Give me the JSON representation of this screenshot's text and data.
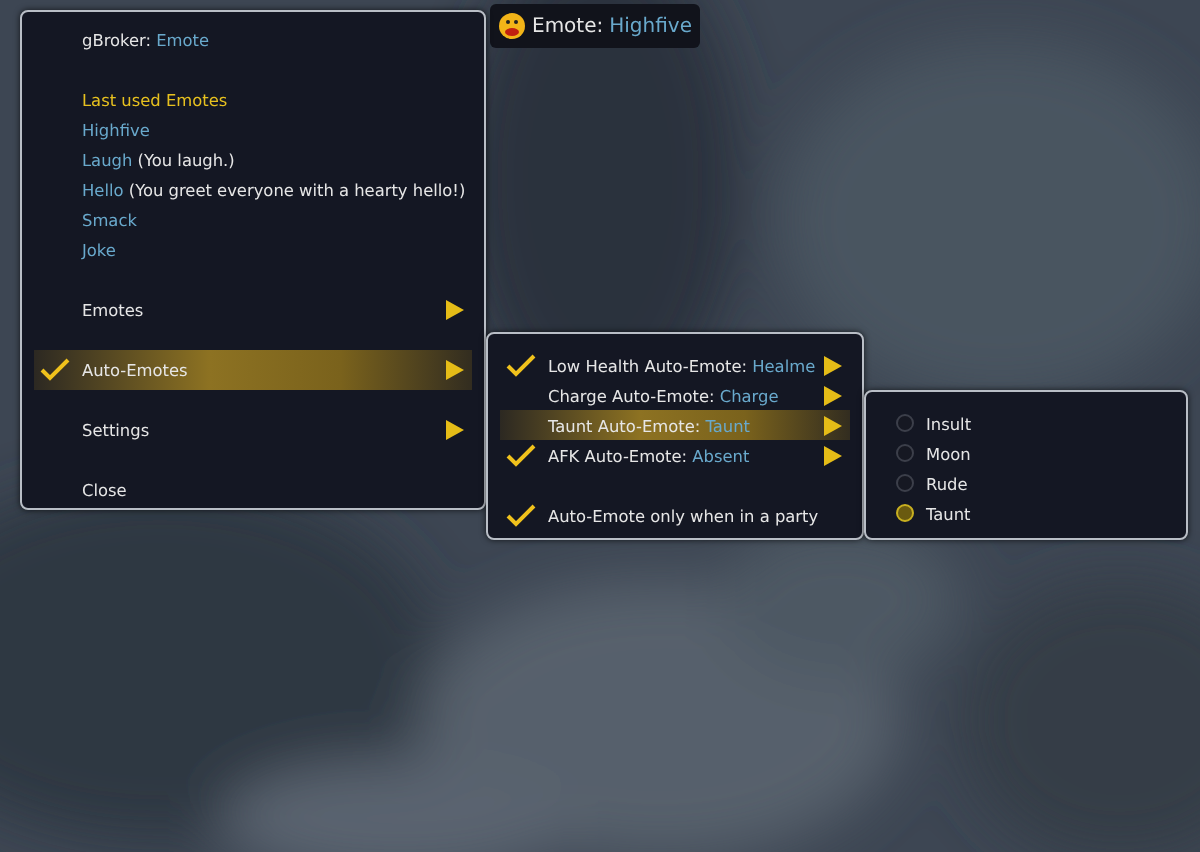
{
  "broker": {
    "label": "Emote:",
    "value": "Highfive"
  },
  "main_menu": {
    "title_label": "gBroker:",
    "title_value": "Emote",
    "section": "Last used Emotes",
    "recent": [
      {
        "name": "Highfive"
      },
      {
        "name": "Laugh",
        "description": "(You laugh.)"
      },
      {
        "name": "Hello",
        "description": "(You greet everyone with a hearty hello!)"
      },
      {
        "name": "Smack"
      },
      {
        "name": "Joke"
      }
    ],
    "items": [
      {
        "label": "Emotes",
        "checked": false,
        "highlighted": false,
        "has_submenu": true
      },
      {
        "label": "Auto-Emotes",
        "checked": true,
        "highlighted": true,
        "has_submenu": true
      },
      {
        "label": "Settings",
        "checked": false,
        "highlighted": false,
        "has_submenu": true
      },
      {
        "label": "Close",
        "checked": false,
        "highlighted": false,
        "has_submenu": false
      }
    ]
  },
  "auto_emotes_menu": {
    "items": [
      {
        "label": "Low Health Auto-Emote:",
        "value": "Healme",
        "checked": true,
        "highlighted": false,
        "has_submenu": true,
        "gap_before": false
      },
      {
        "label": "Charge Auto-Emote:",
        "value": "Charge",
        "checked": false,
        "highlighted": false,
        "has_submenu": true,
        "gap_before": false
      },
      {
        "label": "Taunt Auto-Emote:",
        "value": "Taunt",
        "checked": false,
        "highlighted": true,
        "has_submenu": true,
        "gap_before": false
      },
      {
        "label": "AFK Auto-Emote:",
        "value": "Absent",
        "checked": true,
        "highlighted": false,
        "has_submenu": true,
        "gap_before": false
      },
      {
        "label": "Auto-Emote only when in a party",
        "checked": true,
        "highlighted": false,
        "has_submenu": false,
        "gap_before": true
      }
    ]
  },
  "taunt_menu": {
    "options": [
      {
        "label": "Insult",
        "selected": false
      },
      {
        "label": "Moon",
        "selected": false
      },
      {
        "label": "Rude",
        "selected": false
      },
      {
        "label": "Taunt",
        "selected": true
      }
    ]
  }
}
